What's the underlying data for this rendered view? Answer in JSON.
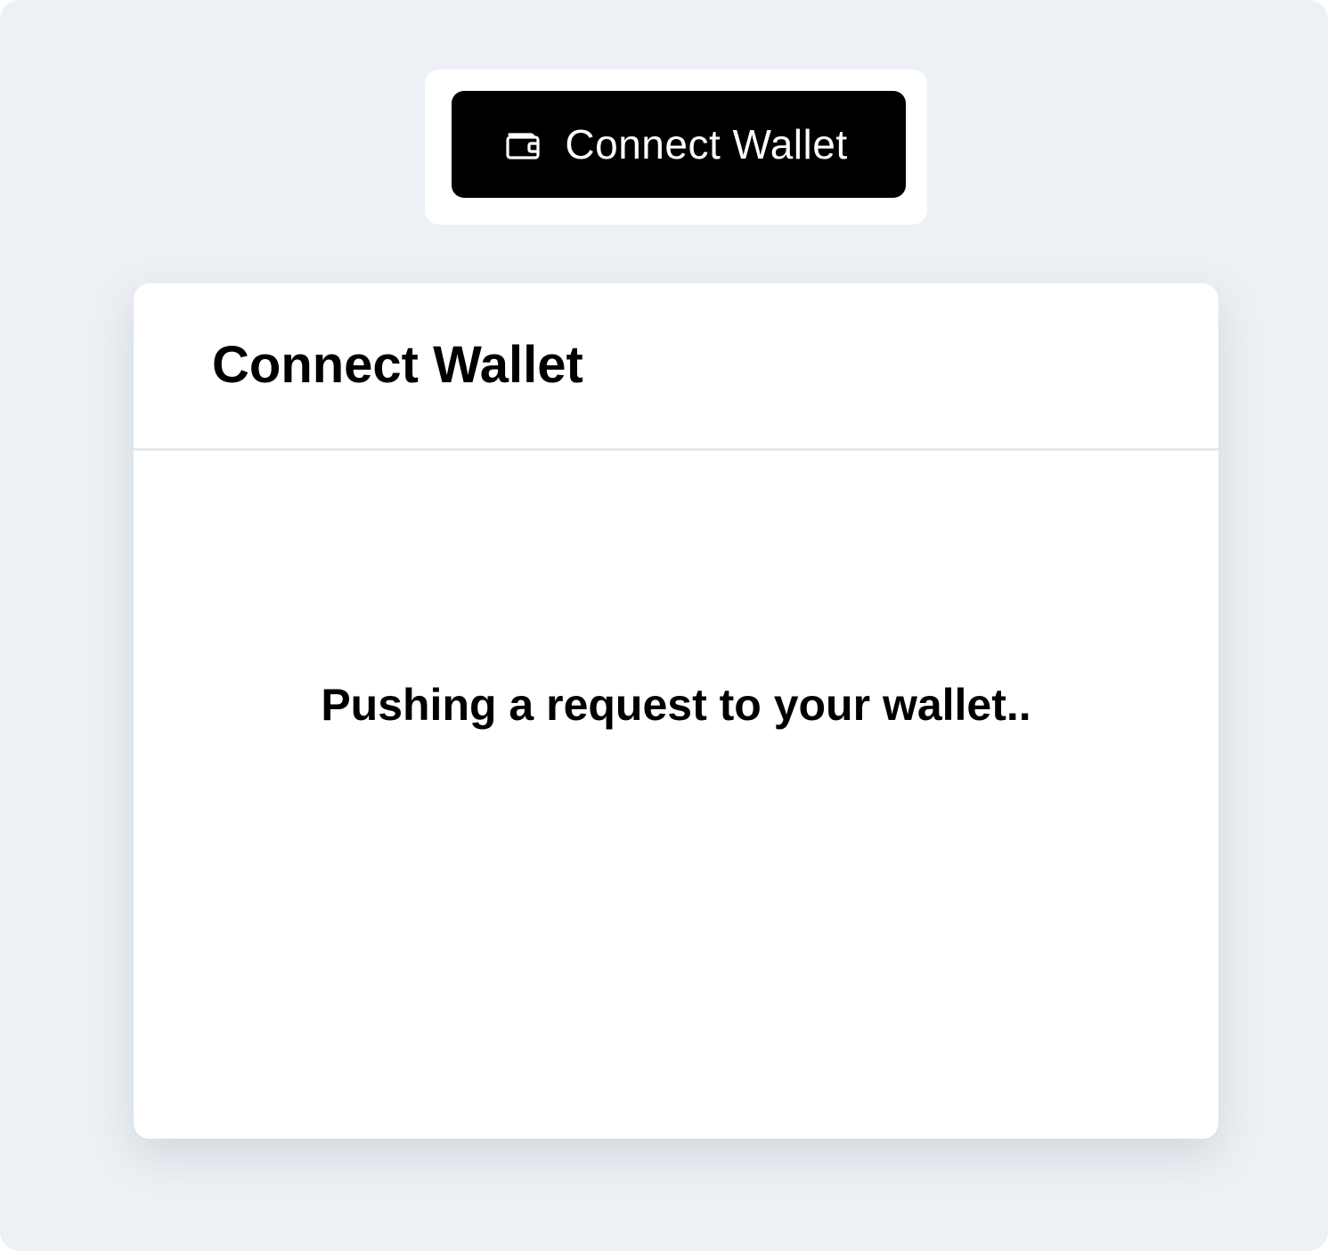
{
  "trigger_button": {
    "label": "Connect Wallet",
    "icon": "wallet-icon"
  },
  "modal": {
    "title": "Connect Wallet",
    "status_text": "Pushing a request to your wallet.."
  },
  "colors": {
    "page_background": "#edf1f5",
    "button_background": "#000000",
    "button_text": "#ffffff",
    "modal_background": "#ffffff",
    "divider": "#e6e9ec"
  }
}
